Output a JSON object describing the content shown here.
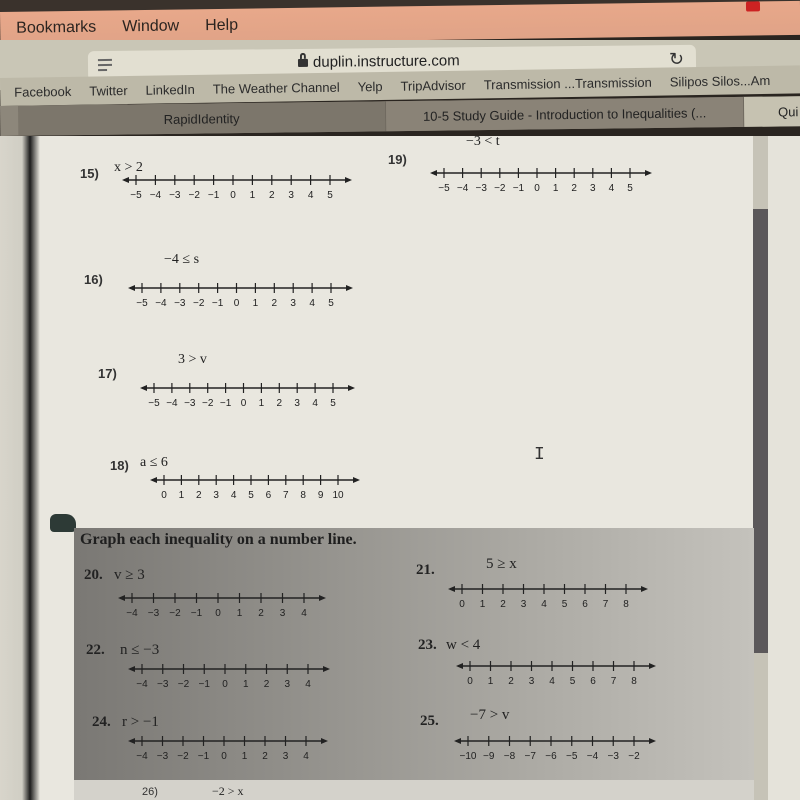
{
  "menubar": {
    "items": [
      "Bookmarks",
      "Window",
      "Help"
    ]
  },
  "toolbar": {
    "url": "duplin.instructure.com",
    "reader_icon": "reader-icon",
    "reload_icon": "reload-icon"
  },
  "bookmarks": [
    "Facebook",
    "Twitter",
    "LinkedIn",
    "The Weather Channel",
    "Yelp",
    "TripAdvisor",
    "Transmission ...Transmission",
    "Silipos Silos...Am"
  ],
  "tabs": [
    {
      "label": "RapidIdentity",
      "active": false
    },
    {
      "label": "10-5 Study Guide - Introduction to Inequalities (...",
      "active": true
    },
    {
      "label": "Qui",
      "active": false
    }
  ],
  "problems": [
    {
      "num": "15)",
      "inequality": "x > 2",
      "ticks": [
        "-5",
        "-4",
        "-3",
        "-2",
        "-1",
        "0",
        "1",
        "2",
        "3",
        "4",
        "5"
      ]
    },
    {
      "num": "16)",
      "inequality": "−4 ≤ s",
      "ticks": [
        "-5",
        "-4",
        "-3",
        "-2",
        "-1",
        "0",
        "1",
        "2",
        "3",
        "4",
        "5"
      ]
    },
    {
      "num": "17)",
      "inequality": "3 > v",
      "ticks": [
        "-5",
        "-4",
        "-3",
        "-2",
        "-1",
        "0",
        "1",
        "2",
        "3",
        "4",
        "5"
      ]
    },
    {
      "num": "18)",
      "inequality": "a ≤ 6",
      "ticks": [
        "0",
        "1",
        "2",
        "3",
        "4",
        "5",
        "6",
        "7",
        "8",
        "9",
        "10"
      ]
    },
    {
      "num": "19)",
      "inequality": "−3 < t",
      "ticks": [
        "-5",
        "-4",
        "-3",
        "-2",
        "-1",
        "0",
        "1",
        "2",
        "3",
        "4",
        "5"
      ]
    }
  ],
  "section": {
    "title": "Graph each inequality on a number line.",
    "problems": [
      {
        "num": "20.",
        "inequality": "v ≥ 3",
        "ticks": [
          "-4",
          "-3",
          "-2",
          "-1",
          "0",
          "1",
          "2",
          "3",
          "4"
        ]
      },
      {
        "num": "21.",
        "inequality": "5 ≥ x",
        "ticks": [
          "0",
          "1",
          "2",
          "3",
          "4",
          "5",
          "6",
          "7",
          "8"
        ]
      },
      {
        "num": "22.",
        "inequality": "n ≤ −3",
        "ticks": [
          "-4",
          "-3",
          "-2",
          "-1",
          "0",
          "1",
          "2",
          "3",
          "4"
        ]
      },
      {
        "num": "23.",
        "inequality": "w < 4",
        "ticks": [
          "0",
          "1",
          "2",
          "3",
          "4",
          "5",
          "6",
          "7",
          "8"
        ]
      },
      {
        "num": "24.",
        "inequality": "r > −1",
        "ticks": [
          "-4",
          "-3",
          "-2",
          "-1",
          "0",
          "1",
          "2",
          "3",
          "4"
        ]
      },
      {
        "num": "25.",
        "inequality": "−7 > v",
        "ticks": [
          "-10",
          "-9",
          "-8",
          "-7",
          "-6",
          "-5",
          "-4",
          "-3",
          "-2"
        ]
      }
    ]
  },
  "footer": {
    "num": "26)",
    "inequality": "−2 > x"
  },
  "scrollbar": {
    "position_fraction": 0.33
  }
}
